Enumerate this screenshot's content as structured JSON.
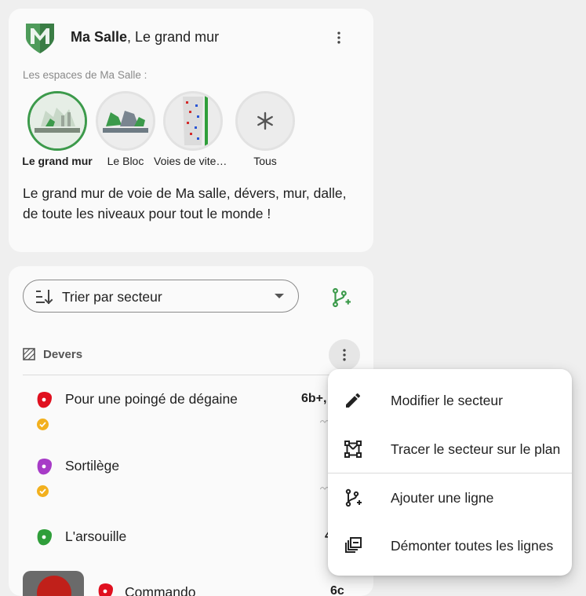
{
  "header": {
    "gym_name": "Ma Salle",
    "wall_suffix": ", Le grand mur",
    "spaces_label": "Les espaces de Ma Salle :"
  },
  "spaces": [
    {
      "label": "Le grand mur",
      "selected": true
    },
    {
      "label": "Le Bloc",
      "selected": false
    },
    {
      "label": "Voies de vitesse",
      "selected": false
    },
    {
      "label": "Tous",
      "selected": false
    }
  ],
  "description": "Le grand mur de voie de Ma salle, dévers, mur, dalle, de toute les niveaux pour tout le monde !",
  "sort": {
    "label": "Trier par secteur"
  },
  "sector": {
    "label": "Devers"
  },
  "routes": [
    {
      "name": "Pour une poingé de dégaine",
      "grade": "6b+,",
      "hold_color": "#e0101f",
      "checked": true
    },
    {
      "name": "Sortilège",
      "grade": "",
      "hold_color": "#a73bc7",
      "checked": true
    },
    {
      "name": "L'arsouille",
      "grade": "4",
      "hold_color": "#2f9e3a",
      "checked": false
    },
    {
      "name": "Commando",
      "grade": "6c",
      "hold_color": "#e0101f",
      "checked": false
    }
  ],
  "menu": {
    "edit_sector": "Modifier le secteur",
    "draw_sector": "Tracer le secteur sur le plan",
    "add_line": "Ajouter une ligne",
    "dismount_all": "Démonter toutes les lignes"
  },
  "colors": {
    "accent": "#3c9a4b",
    "warning": "#f2b01e"
  }
}
